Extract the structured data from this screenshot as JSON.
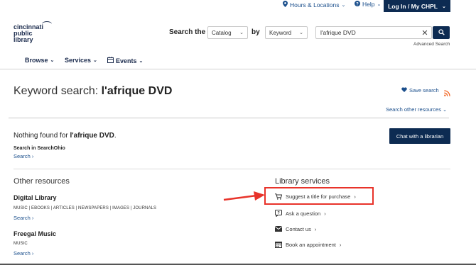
{
  "topbar": {
    "hours_label": "Hours & Locations",
    "help_label": "Help",
    "login_label": "Log In / My CHPL"
  },
  "logo": {
    "line1": "cincinnati",
    "line2": "public",
    "line3": "library"
  },
  "search": {
    "search_the_label": "Search the",
    "scope_value": "Catalog",
    "by_label": "by",
    "type_value": "Keyword",
    "query_value": "l'afrique DVD",
    "advanced_label": "Advanced Search"
  },
  "nav": {
    "browse": "Browse",
    "services": "Services",
    "events": "Events"
  },
  "main": {
    "title_prefix": "Keyword search: ",
    "title_query": "l'afrique DVD",
    "save_search": "Save search",
    "other_resources_link": "Search other resources",
    "nothing_prefix": "Nothing found for ",
    "nothing_query": "l'afrique DVD",
    "nothing_suffix": ".",
    "ohio_label": "Search in SearchOhio",
    "ohio_search": "Search",
    "chat_button": "Chat with a librarian"
  },
  "other_resources": {
    "heading": "Other resources",
    "items": [
      {
        "title": "Digital Library",
        "meta": "MUSIC | EBOOKS | ARTICLES | NEWSPAPERS | IMAGES | JOURNALS",
        "link": "Search"
      },
      {
        "title": "Freegal Music",
        "meta": "MUSIC",
        "link": "Search"
      }
    ]
  },
  "library_services": {
    "heading": "Library services",
    "items": [
      {
        "label": "Suggest a title for purchase",
        "icon": "cart-icon"
      },
      {
        "label": "Ask a question",
        "icon": "question-bubble-icon"
      },
      {
        "label": "Contact us",
        "icon": "envelope-icon"
      },
      {
        "label": "Book an appointment",
        "icon": "calendar-icon"
      }
    ]
  },
  "colors": {
    "navy": "#0d2b52",
    "link": "#1b4f8c",
    "highlight": "#e8332a",
    "rss": "#f26522"
  }
}
